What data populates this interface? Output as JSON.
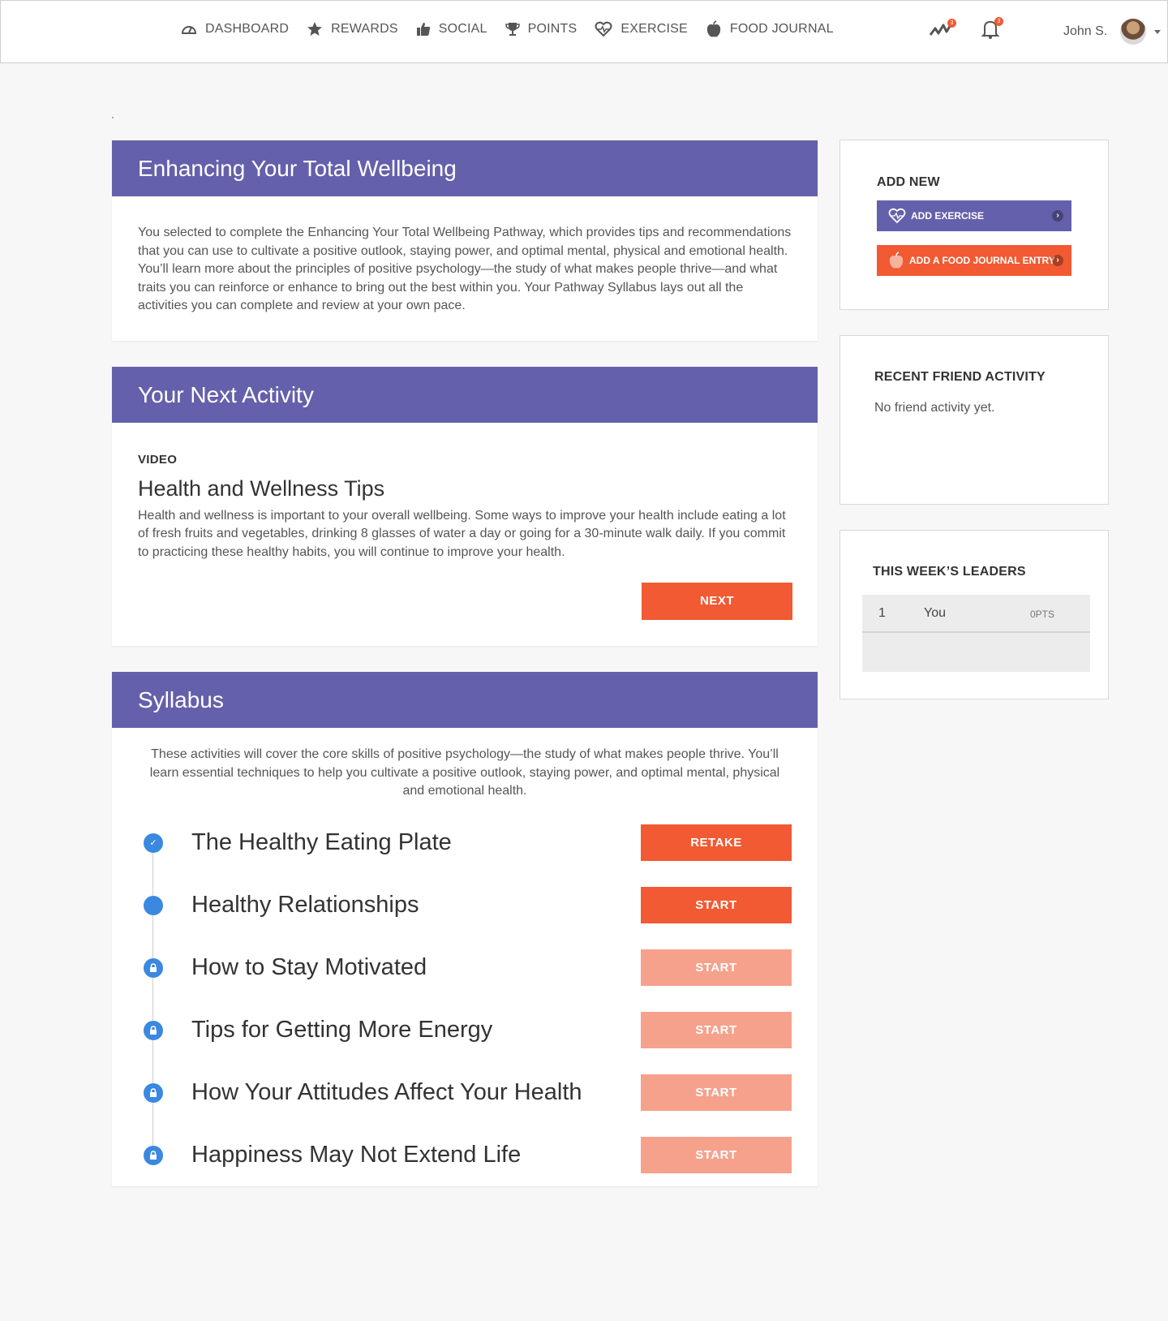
{
  "nav": {
    "items": [
      {
        "label": "DASHBOARD",
        "icon": "dashboard-icon"
      },
      {
        "label": "REWARDS",
        "icon": "star-icon"
      },
      {
        "label": "SOCIAL",
        "icon": "thumbs-up-icon"
      },
      {
        "label": "POINTS",
        "icon": "trophy-icon"
      },
      {
        "label": "EXERCISE",
        "icon": "heartbeat-icon"
      },
      {
        "label": "FOOD JOURNAL",
        "icon": "apple-icon"
      }
    ],
    "activity_badge": "3",
    "notification_badge": "3",
    "user_name": "John S."
  },
  "intro": {
    "title": "Enhancing Your Total Wellbeing",
    "body": "You selected to complete the Enhancing Your Total Wellbeing Pathway, which provides tips and recommendations that you can use to cultivate a positive outlook, staying power, and optimal mental, physical and emotional health. You’ll learn more about the principles of positive psychology—the study of what makes people thrive—and what traits you can reinforce or enhance to bring out the best within you. Your Pathway Syllabus lays out all the activities you can complete and review at your own pace."
  },
  "next_activity": {
    "title": "Your Next Activity",
    "type": "VIDEO",
    "activity_title": "Health and Wellness Tips",
    "description": "Health and wellness is important to your overall wellbeing. Some ways to improve your health include eating a lot of fresh fruits and vegetables, drinking 8 glasses of water a day or going for a 30-minute walk daily. If you commit to practicing these healthy habits, you will continue to improve your health.",
    "button": "NEXT"
  },
  "syllabus": {
    "title": "Syllabus",
    "intro": "These activities will cover the core skills of positive psychology—the study of what makes people thrive. You’ll learn essential techniques to help you cultivate a positive outlook, staying power, and optimal mental, physical and emotional health.",
    "items": [
      {
        "title": "The Healthy Eating Plate",
        "button": "RETAKE",
        "status": "completed"
      },
      {
        "title": "Healthy Relationships",
        "button": "START",
        "status": "current"
      },
      {
        "title": "How to Stay Motivated",
        "button": "START",
        "status": "locked"
      },
      {
        "title": "Tips for Getting More Energy",
        "button": "START",
        "status": "locked"
      },
      {
        "title": "How Your Attitudes Affect Your Health",
        "button": "START",
        "status": "locked"
      },
      {
        "title": "Happiness May Not Extend Life",
        "button": "START",
        "status": "locked"
      }
    ]
  },
  "sidebar": {
    "add_new": {
      "title": "ADD NEW",
      "exercise_button": "ADD EXERCISE",
      "food_button": "ADD A FOOD JOURNAL ENTRY"
    },
    "friend_activity": {
      "title": "RECENT FRIEND ACTIVITY",
      "empty_text": "No friend activity yet."
    },
    "leaders": {
      "title": "THIS WEEK’S LEADERS",
      "rows": [
        {
          "rank": "1",
          "name": "You",
          "points": "0PTS"
        }
      ]
    }
  },
  "colors": {
    "purple": "#6560ab",
    "orange": "#f15a32",
    "orange_light": "#f6a18c",
    "blue": "#3a88e0"
  }
}
